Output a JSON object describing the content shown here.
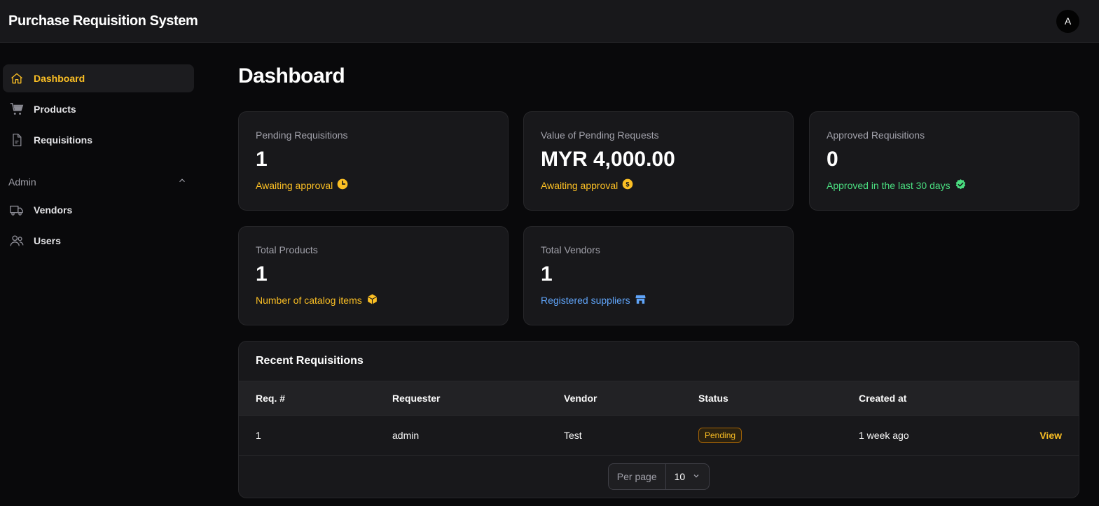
{
  "app": {
    "title": "Purchase Requisition System",
    "avatar_initial": "A"
  },
  "sidebar": {
    "items": [
      {
        "label": "Dashboard",
        "icon": "home-icon",
        "active": true
      },
      {
        "label": "Products",
        "icon": "cart-icon"
      },
      {
        "label": "Requisitions",
        "icon": "document-icon"
      }
    ],
    "admin_group": {
      "label": "Admin",
      "expanded": true,
      "items": [
        {
          "label": "Vendors",
          "icon": "truck-icon"
        },
        {
          "label": "Users",
          "icon": "users-icon"
        }
      ]
    }
  },
  "page": {
    "title": "Dashboard"
  },
  "stats": [
    {
      "label": "Pending Requisitions",
      "value": "1",
      "description": "Awaiting approval",
      "icon": "clock-icon",
      "color": "#fbbf24"
    },
    {
      "label": "Value of Pending Requests",
      "value": "MYR 4,000.00",
      "description": "Awaiting approval",
      "icon": "dollar-icon",
      "color": "#fbbf24"
    },
    {
      "label": "Approved Requisitions",
      "value": "0",
      "description": "Approved in the last 30 days",
      "icon": "check-badge-icon",
      "color": "#4ade80"
    },
    {
      "label": "Total Products",
      "value": "1",
      "description": "Number of catalog items",
      "icon": "cube-icon",
      "color": "#fbbf24"
    },
    {
      "label": "Total Vendors",
      "value": "1",
      "description": "Registered suppliers",
      "icon": "storefront-icon",
      "color": "#60a5fa"
    }
  ],
  "recent": {
    "title": "Recent Requisitions",
    "columns": [
      "Req. #",
      "Requester",
      "Vendor",
      "Status",
      "Created at"
    ],
    "rows": [
      {
        "req": "1",
        "requester": "admin",
        "vendor": "Test",
        "status": "Pending",
        "created": "1 week ago",
        "action": "View"
      }
    ],
    "pagination": {
      "label": "Per page",
      "value": "10"
    }
  },
  "colors": {
    "accent": "#fbbf24",
    "background": "#09090b",
    "card": "#18181b"
  }
}
